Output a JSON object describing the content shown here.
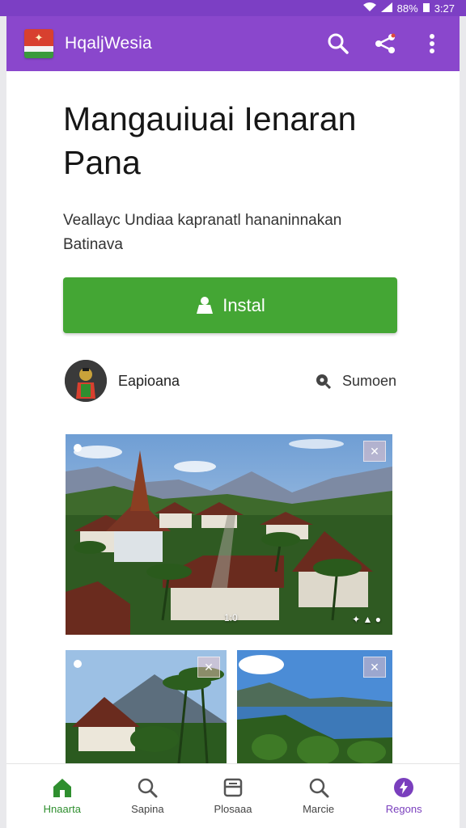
{
  "status_bar": {
    "battery": "88%",
    "time": "3:27"
  },
  "app_bar": {
    "title": "HqaljWesia",
    "actions": [
      {
        "icon": "search-icon"
      },
      {
        "icon": "share-icon"
      },
      {
        "icon": "more-vert-icon"
      }
    ]
  },
  "content": {
    "headline_line1": "Mangauiuai Ienaran",
    "headline_line2": "Pana",
    "subtitle_line1": "Veallayc Undiaa kapranatl hananinnakan",
    "subtitle_line2": "Batinava",
    "install_label": "Instal",
    "developer_name": "Eapioana",
    "source_label": "Sumoen"
  },
  "screenshots": {
    "main_time": "1:0",
    "main_corner": "✦ ▲ ●"
  },
  "bottom_nav": [
    {
      "label": "Hnaarta",
      "icon": "home-icon",
      "state": "active"
    },
    {
      "label": "Sapina",
      "icon": "search-icon",
      "state": "normal"
    },
    {
      "label": "Plosaaa",
      "icon": "library-icon",
      "state": "normal"
    },
    {
      "label": "Marcie",
      "icon": "search-icon",
      "state": "normal"
    },
    {
      "label": "Regons",
      "icon": "bolt-icon",
      "state": "accent"
    }
  ],
  "colors": {
    "app_bar": "#8a47cc",
    "install": "#44a634",
    "nav_active": "#2f8f2f",
    "nav_accent": "#7a3fbd"
  }
}
